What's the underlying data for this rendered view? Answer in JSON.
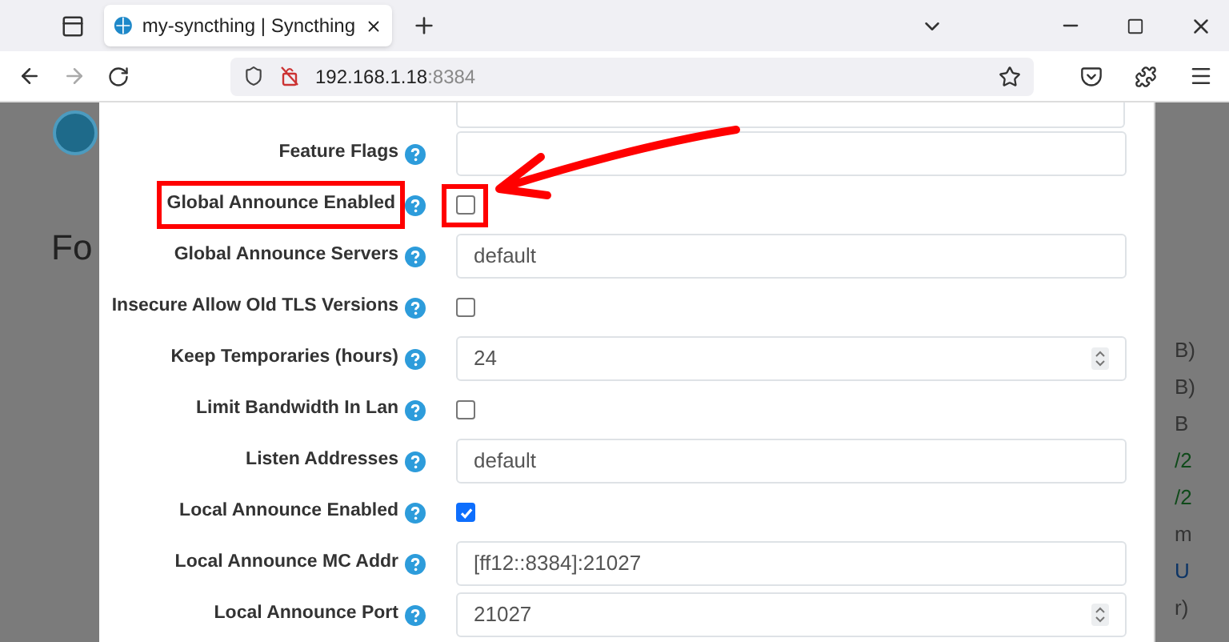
{
  "browser": {
    "tab_title": "my-syncthing | Syncthing",
    "url_host": "192.168.1.18",
    "url_port": ":8384"
  },
  "background": {
    "heading": "Fo",
    "fragments": [
      {
        "text": "B)",
        "color": "#333333"
      },
      {
        "text": "B)",
        "color": "#333333"
      },
      {
        "text": "B",
        "color": "#333333"
      },
      {
        "text": "/2",
        "color": "#0f4a1a"
      },
      {
        "text": "/2",
        "color": "#0f4a1a"
      },
      {
        "text": "m",
        "color": "#333333"
      },
      {
        "text": "U",
        "color": "#0d3566"
      },
      {
        "text": "r)",
        "color": "#333333"
      }
    ]
  },
  "settings": [
    {
      "label": "Feature Flags",
      "kind": "text"
    },
    {
      "label": "Global Announce Enabled",
      "kind": "checkbox",
      "checked": false,
      "highlighted": true
    },
    {
      "label": "Global Announce Servers",
      "kind": "text",
      "value": "default"
    },
    {
      "label": "Insecure Allow Old TLS Versions",
      "kind": "checkbox",
      "checked": false
    },
    {
      "label": "Keep Temporaries (hours)",
      "kind": "number",
      "value": "24"
    },
    {
      "label": "Limit Bandwidth In Lan",
      "kind": "checkbox",
      "checked": false
    },
    {
      "label": "Listen Addresses",
      "kind": "text",
      "value": "default"
    },
    {
      "label": "Local Announce Enabled",
      "kind": "checkbox",
      "checked": true
    },
    {
      "label": "Local Announce MC Addr",
      "kind": "text",
      "value": "[ff12::8384]:21027"
    },
    {
      "label": "Local Announce Port",
      "kind": "number",
      "value": "21027"
    }
  ]
}
